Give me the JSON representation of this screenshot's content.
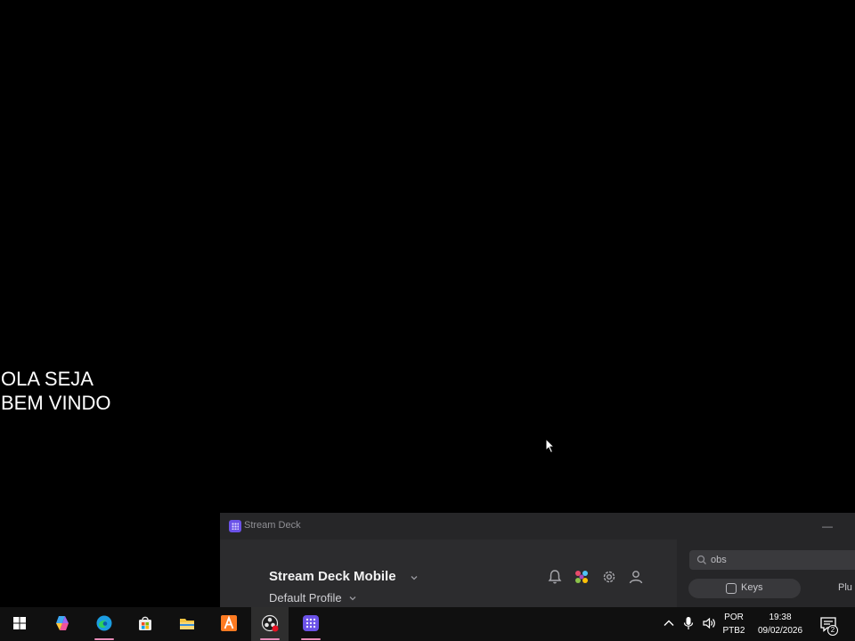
{
  "desktop": {
    "welcome_line1": "OLA SEJA",
    "welcome_line2": "BEM VINDO"
  },
  "stream_deck": {
    "window_title": "Stream Deck",
    "minimize_label": "—",
    "device_name": "Stream Deck Mobile",
    "profile_name": "Default Profile",
    "search_value": "obs",
    "tab_keys": "Keys",
    "tab_plugins": "Plu",
    "icons": [
      "bell-icon",
      "store-icon",
      "gear-icon",
      "user-icon",
      "search-icon",
      "keys-icon",
      "chevron-down-icon"
    ],
    "accent_color": "#6b52e8"
  },
  "taskbar": {
    "apps": [
      {
        "name": "windows-start",
        "icon": "windows-logo-icon"
      },
      {
        "name": "copilot",
        "icon": "copilot-icon"
      },
      {
        "name": "edge",
        "icon": "edge-icon",
        "running": true
      },
      {
        "name": "microsoft-store",
        "icon": "store-bag-icon"
      },
      {
        "name": "file-explorer",
        "icon": "folder-icon"
      },
      {
        "name": "orange-app",
        "icon": "orange-a-icon"
      },
      {
        "name": "obs-studio",
        "icon": "obs-icon",
        "running": true,
        "active": true
      },
      {
        "name": "stream-deck",
        "icon": "stream-deck-icon",
        "running": true
      }
    ],
    "language_line1": "POR",
    "language_line2": "PTB2",
    "time": "19:38",
    "date": "09/02/2026",
    "notification_count": "2",
    "underline_color": "#e88bb8"
  }
}
